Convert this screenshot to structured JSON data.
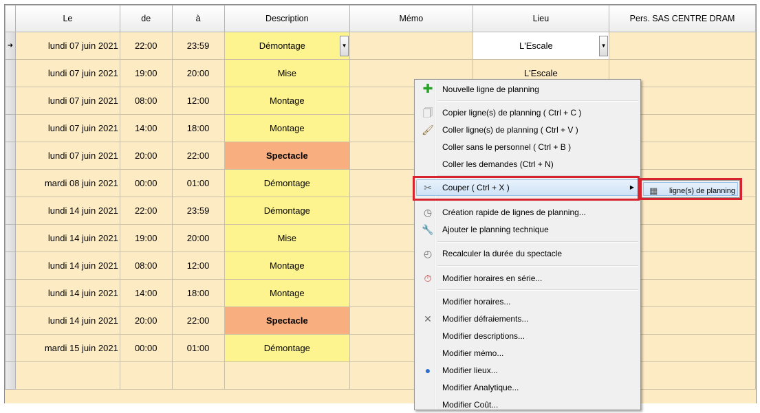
{
  "columns": {
    "date": "Le",
    "start": "de",
    "end": "à",
    "description": "Description",
    "memo": "Mémo",
    "lieu": "Lieu",
    "staff": "Pers. SAS CENTRE DRAM"
  },
  "current_row_marker": "➜",
  "rows": [
    {
      "date": "lundi 07 juin 2021",
      "start": "22:00",
      "end": "23:59",
      "description": "Démontage",
      "lieu": "L'Escale"
    },
    {
      "date": "lundi 07 juin 2021",
      "start": "19:00",
      "end": "20:00",
      "description": "Mise",
      "lieu": "L'Escale"
    },
    {
      "date": "lundi 07 juin 2021",
      "start": "08:00",
      "end": "12:00",
      "description": "Montage",
      "lieu": ""
    },
    {
      "date": "lundi 07 juin 2021",
      "start": "14:00",
      "end": "18:00",
      "description": "Montage",
      "lieu": ""
    },
    {
      "date": "lundi 07 juin 2021",
      "start": "20:00",
      "end": "22:00",
      "description": "Spectacle",
      "lieu": ""
    },
    {
      "date": "mardi 08 juin 2021",
      "start": "00:00",
      "end": "01:00",
      "description": "Démontage",
      "lieu": ""
    },
    {
      "date": "lundi 14 juin 2021",
      "start": "22:00",
      "end": "23:59",
      "description": "Démontage",
      "lieu": ""
    },
    {
      "date": "lundi 14 juin 2021",
      "start": "19:00",
      "end": "20:00",
      "description": "Mise",
      "lieu": ""
    },
    {
      "date": "lundi 14 juin 2021",
      "start": "08:00",
      "end": "12:00",
      "description": "Montage",
      "lieu": ""
    },
    {
      "date": "lundi 14 juin 2021",
      "start": "14:00",
      "end": "18:00",
      "description": "Montage",
      "lieu": ""
    },
    {
      "date": "lundi 14 juin 2021",
      "start": "20:00",
      "end": "22:00",
      "description": "Spectacle",
      "lieu": ""
    },
    {
      "date": "mardi 15 juin 2021",
      "start": "00:00",
      "end": "01:00",
      "description": "Démontage",
      "lieu": ""
    }
  ],
  "context_menu": {
    "items": [
      {
        "label": "Nouvelle ligne de planning",
        "icon": "plus-icon"
      },
      {
        "label": "Copier ligne(s) de planning ( Ctrl + C )",
        "icon": "copy-icon"
      },
      {
        "label": "Coller ligne(s) de planning ( Ctrl + V )",
        "icon": "paste-brush-icon"
      },
      {
        "label": "Coller sans le personnel ( Ctrl + B )",
        "icon": ""
      },
      {
        "label": "Coller les demandes (Ctrl + N)",
        "icon": ""
      },
      {
        "label": "Couper ( Ctrl + X )",
        "icon": "scissors-icon"
      },
      {
        "label": "Création rapide de lignes de planning...",
        "icon": "clock-icon"
      },
      {
        "label": "Ajouter le planning technique",
        "icon": "wrench-icon"
      },
      {
        "label": "Recalculer la durée du spectacle",
        "icon": "clock-grey-icon"
      },
      {
        "label": "Modifier horaires en série...",
        "icon": "stopwatch-icon"
      },
      {
        "label": "Modifier horaires...",
        "icon": ""
      },
      {
        "label": "Modifier défraiements...",
        "icon": "tools-icon"
      },
      {
        "label": "Modifier descriptions...",
        "icon": ""
      },
      {
        "label": "Modifier mémo...",
        "icon": ""
      },
      {
        "label": "Modifier lieux...",
        "icon": "globe-icon"
      },
      {
        "label": "Modifier Analytique...",
        "icon": ""
      },
      {
        "label": "Modifier Coût...",
        "icon": ""
      }
    ]
  },
  "submenu": {
    "item": {
      "label": "ligne(s) de planning",
      "icon": "calendar-icon"
    }
  },
  "colors": {
    "row_bg": "#fdebc4",
    "description_bg": "#fdf38f",
    "spectacle_bg": "#f9ae7f",
    "highlight_border": "#d7232e"
  }
}
